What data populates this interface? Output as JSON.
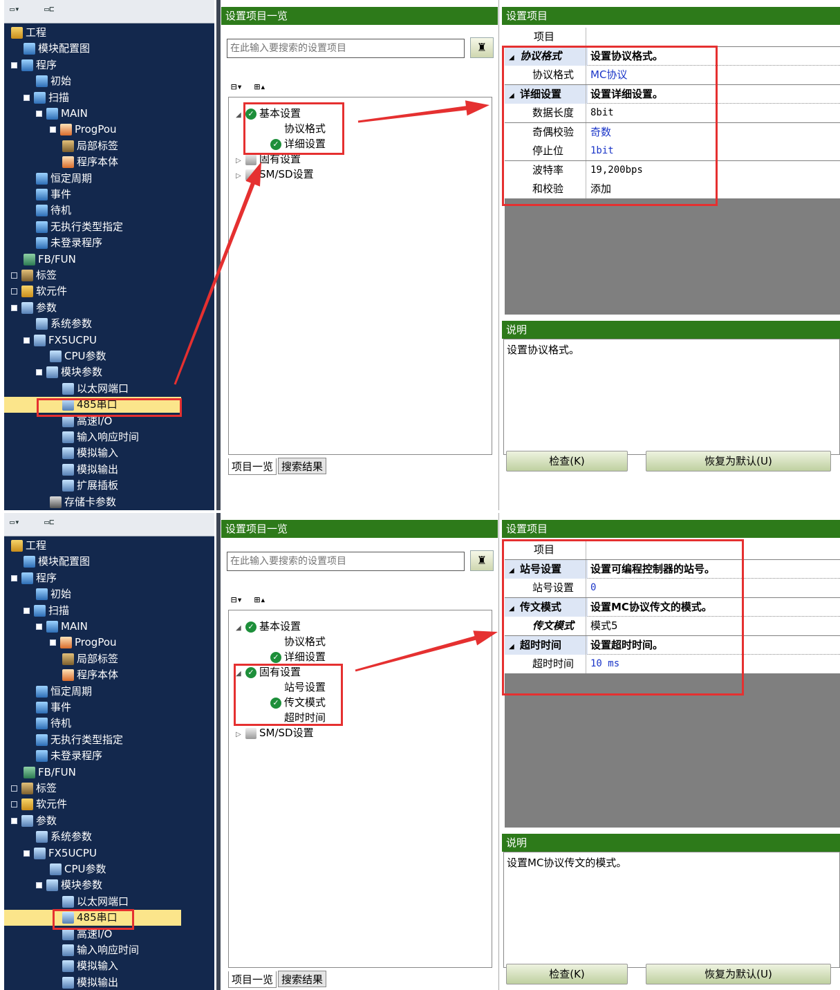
{
  "nav_toolbar": {
    "icon1": "tree-toggle-icon",
    "icon2": "tree-collapse-icon"
  },
  "nav_tree": [
    {
      "label": "工程",
      "depth": 0
    },
    {
      "label": "模块配置图",
      "depth": 1
    },
    {
      "label": "程序",
      "depth": 0,
      "exp": "open"
    },
    {
      "label": "初始",
      "depth": 2
    },
    {
      "label": "扫描",
      "depth": 1,
      "exp": "open"
    },
    {
      "label": "MAIN",
      "depth": 2,
      "exp": "open"
    },
    {
      "label": "ProgPou",
      "depth": 3,
      "exp": "open"
    },
    {
      "label": "局部标签",
      "depth": 4
    },
    {
      "label": "程序本体",
      "depth": 4
    },
    {
      "label": "恒定周期",
      "depth": 2
    },
    {
      "label": "事件",
      "depth": 2
    },
    {
      "label": "待机",
      "depth": 2
    },
    {
      "label": "无执行类型指定",
      "depth": 2
    },
    {
      "label": "未登录程序",
      "depth": 2
    },
    {
      "label": "FB/FUN",
      "depth": 1
    },
    {
      "label": "标签",
      "depth": 0,
      "exp": "closed"
    },
    {
      "label": "软元件",
      "depth": 0,
      "exp": "closed"
    },
    {
      "label": "参数",
      "depth": 0,
      "exp": "open"
    },
    {
      "label": "系统参数",
      "depth": 2
    },
    {
      "label": "FX5UCPU",
      "depth": 1,
      "exp": "open"
    },
    {
      "label": "CPU参数",
      "depth": 3
    },
    {
      "label": "模块参数",
      "depth": 2,
      "exp": "open"
    },
    {
      "label": "以太网端口",
      "depth": 4
    },
    {
      "label": "485串口",
      "depth": 4,
      "selected": true
    },
    {
      "label": "高速I/O",
      "depth": 4
    },
    {
      "label": "输入响应时间",
      "depth": 4
    },
    {
      "label": "模拟输入",
      "depth": 4
    },
    {
      "label": "模拟输出",
      "depth": 4
    },
    {
      "label": "扩展插板",
      "depth": 4
    },
    {
      "label": "存储卡参数",
      "depth": 3
    }
  ],
  "list_header": "设置项目一览",
  "setting_header": "设置项目",
  "search_placeholder": "在此输入要搜索的设置项目",
  "desc_header": "说明",
  "tab_list": "项目一览",
  "tab_search": "搜索结果",
  "btn_check": "检查(K)",
  "btn_default": "恢复为默认(U)",
  "panel1": {
    "items": [
      {
        "label": "基本设置",
        "type": "cat",
        "check": true,
        "exp": "open"
      },
      {
        "label": "协议格式",
        "type": "leaf"
      },
      {
        "label": "详细设置",
        "type": "leaf",
        "check": true
      },
      {
        "label": "固有设置",
        "type": "cat",
        "exp": "closed"
      },
      {
        "label": "SM/SD设置",
        "type": "cat",
        "exp": "closed"
      }
    ],
    "grid": [
      {
        "c1": "项目",
        "c2": "",
        "type": "head"
      },
      {
        "c1": "协议格式",
        "c2": "设置协议格式。",
        "type": "cat",
        "italic": true
      },
      {
        "c1": "协议格式",
        "c2": "MC协议",
        "type": "sub",
        "blue": true
      },
      {
        "c1": "详细设置",
        "c2": "设置详细设置。",
        "type": "cat"
      },
      {
        "c1": "数据长度",
        "c2": "8bit",
        "type": "sub",
        "mono": true
      },
      {
        "c1": "奇偶校验",
        "c2": "奇数",
        "type": "sub",
        "blue": true
      },
      {
        "c1": "停止位",
        "c2": "1bit",
        "type": "sub",
        "blue": true,
        "mono": true
      },
      {
        "c1": "波特率",
        "c2": "19,200bps",
        "type": "sub",
        "mono": true
      },
      {
        "c1": "和校验",
        "c2": "添加",
        "type": "sub"
      }
    ],
    "description": "设置协议格式。"
  },
  "panel2": {
    "items": [
      {
        "label": "基本设置",
        "type": "cat",
        "check": true,
        "exp": "open"
      },
      {
        "label": "协议格式",
        "type": "leaf"
      },
      {
        "label": "详细设置",
        "type": "leaf",
        "check": true
      },
      {
        "label": "固有设置",
        "type": "cat",
        "check": true,
        "exp": "open"
      },
      {
        "label": "站号设置",
        "type": "leaf"
      },
      {
        "label": "传文模式",
        "type": "leaf",
        "check": true
      },
      {
        "label": "超时时间",
        "type": "leaf"
      },
      {
        "label": "SM/SD设置",
        "type": "cat",
        "exp": "closed"
      }
    ],
    "grid": [
      {
        "c1": "项目",
        "c2": "",
        "type": "head"
      },
      {
        "c1": "站号设置",
        "c2": "设置可编程控制器的站号。",
        "type": "cat"
      },
      {
        "c1": "站号设置",
        "c2": "0",
        "type": "sub",
        "blue": true,
        "mono": true
      },
      {
        "c1": "传文模式",
        "c2": "设置MC协议传文的模式。",
        "type": "cat"
      },
      {
        "c1": "传文模式",
        "c2": "模式5",
        "type": "sub",
        "italic": true
      },
      {
        "c1": "超时时间",
        "c2": "设置超时时间。",
        "type": "cat"
      },
      {
        "c1": "超时时间",
        "c2": "10 ms",
        "type": "sub",
        "blue": true,
        "mono": true
      }
    ],
    "description": "设置MC协议传文的模式。"
  },
  "colors": {
    "header_green": "#2d7a1a",
    "nav_bg": "#13284d",
    "highlight": "#fbe58b",
    "annotation_red": "#e53030"
  }
}
